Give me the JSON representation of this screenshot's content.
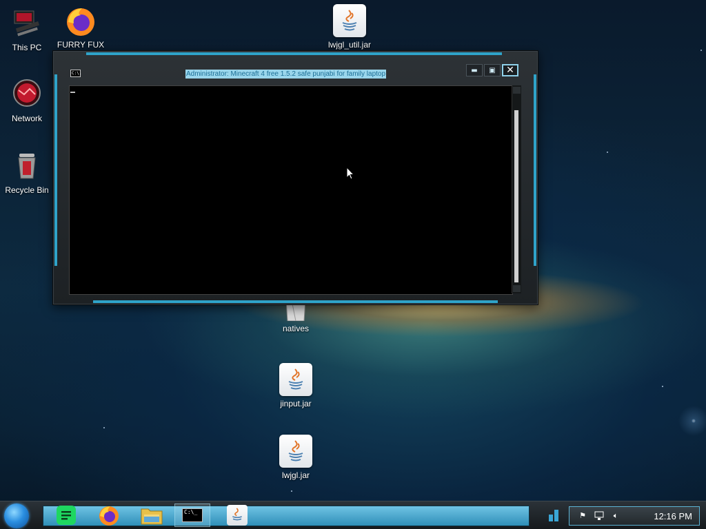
{
  "desktop": {
    "icons": [
      {
        "label": "This PC"
      },
      {
        "label": "FURRY FUX"
      },
      {
        "label": "lwjgl_util.jar"
      },
      {
        "label": "Network"
      },
      {
        "label": "Recycle Bin"
      },
      {
        "label": "natives"
      },
      {
        "label": "jinput.jar"
      },
      {
        "label": "lwjgl.jar"
      }
    ]
  },
  "window": {
    "title": "Administrator:  Minecraft 4 free 1.5.2 safe punjabi for family laptop",
    "icon_text": "C:\\.",
    "icon": "cmd-icon",
    "buttons": [
      {
        "name": "minimize",
        "icon": "minimize-icon"
      },
      {
        "name": "maximize",
        "icon": "maximize-icon"
      },
      {
        "name": "close",
        "icon": "close-icon"
      }
    ]
  },
  "taskbar": {
    "items": [
      {
        "name": "spotify",
        "icon": "spotify-icon"
      },
      {
        "name": "firefox",
        "icon": "firefox-icon"
      },
      {
        "name": "file-explorer",
        "icon": "folder-icon"
      },
      {
        "name": "command-prompt",
        "icon": "terminal-icon",
        "active": true,
        "icon_text": "C:\\_"
      },
      {
        "name": "java",
        "icon": "java-icon"
      }
    ],
    "clock": "12:16 PM"
  },
  "colors": {
    "accent": "#2fa3c9",
    "title_highlight": "#9ad6ec",
    "title_text": "#1c6f96"
  }
}
